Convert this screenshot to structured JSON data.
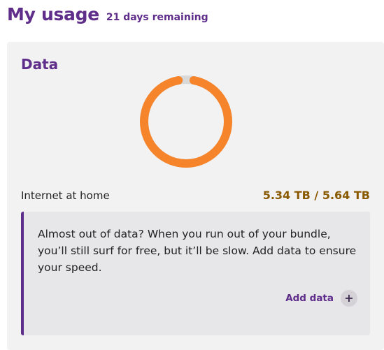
{
  "header": {
    "title": "My usage",
    "days_remaining": "21 days remaining"
  },
  "data_card": {
    "title": "Data",
    "usage_label": "Internet at home",
    "usage_value": "5.34 TB / 5.64 TB",
    "used_fraction": 0.947,
    "ring_color": "#f5842a",
    "remaining_color": "#d9d9d9",
    "notice_text": "Almost out of data? When you run out of your bundle, you’ll still surf for free, but it’ll be slow. Add data to ensure your speed.",
    "add_data_label": "Add data",
    "add_icon": "plus-icon"
  },
  "colors": {
    "brand_purple": "#5f2d8a",
    "value_brown": "#8a5a00"
  }
}
